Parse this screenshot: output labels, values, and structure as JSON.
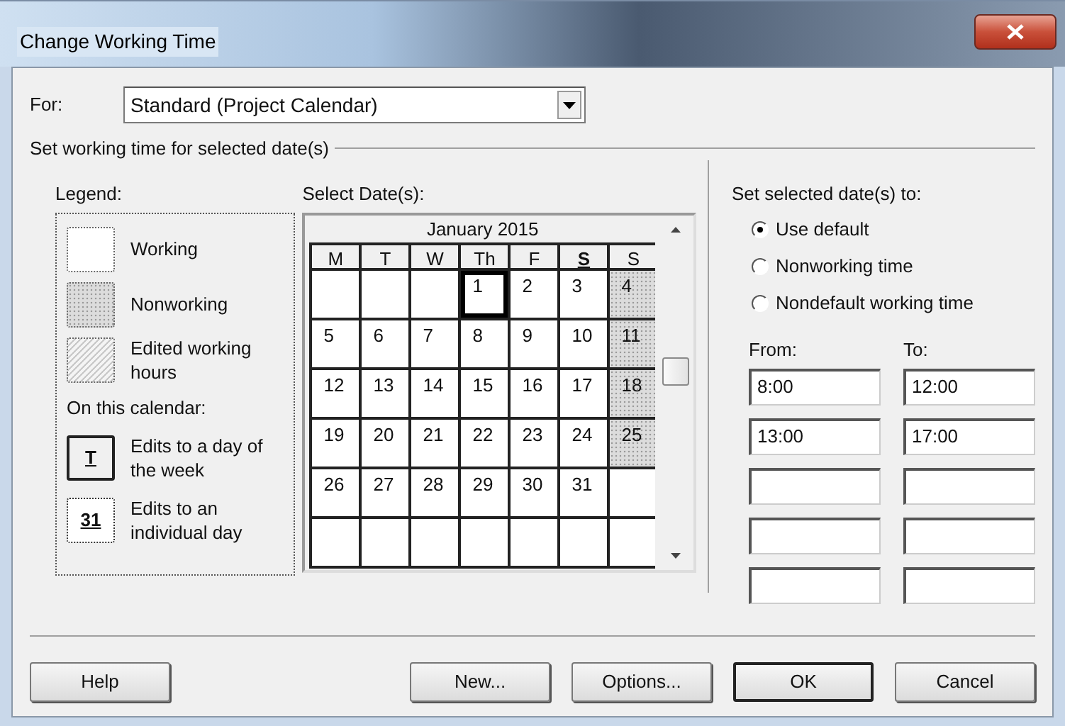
{
  "window": {
    "title": "Change Working Time"
  },
  "for_field": {
    "label": "For:",
    "value": "Standard (Project Calendar)"
  },
  "section_title": "Set working time for selected date(s)",
  "legend": {
    "title": "Legend:",
    "items": [
      {
        "kind": "working",
        "label": "Working"
      },
      {
        "kind": "nonworking",
        "label": "Nonworking"
      },
      {
        "kind": "edited",
        "label": "Edited working hours"
      }
    ],
    "subtitle": "On this calendar:",
    "calendar_items": [
      {
        "kind": "weekday",
        "symbol": "T",
        "label": "Edits to a day of the week"
      },
      {
        "kind": "day",
        "symbol": "31",
        "label": "Edits to an individual day"
      }
    ]
  },
  "calendar": {
    "label": "Select Date(s):",
    "month": "January 2015",
    "headers": [
      {
        "label": "M",
        "marked": false
      },
      {
        "label": "T",
        "marked": false
      },
      {
        "label": "W",
        "marked": false
      },
      {
        "label": "Th",
        "marked": false
      },
      {
        "label": "F",
        "marked": false
      },
      {
        "label": "S",
        "marked": true
      },
      {
        "label": "S",
        "marked": false
      }
    ],
    "weeks": [
      [
        {
          "kind": "blank",
          "selected": false
        },
        {
          "kind": "blank",
          "selected": false
        },
        {
          "kind": "blank",
          "selected": false
        },
        {
          "kind": "working",
          "day": "1",
          "selected": true
        },
        {
          "kind": "working",
          "day": "2",
          "selected": false
        },
        {
          "kind": "working",
          "day": "3",
          "selected": false
        },
        {
          "kind": "nonworking",
          "day": "4",
          "selected": false
        }
      ],
      [
        {
          "kind": "working",
          "day": "5",
          "selected": false
        },
        {
          "kind": "working",
          "day": "6",
          "selected": false
        },
        {
          "kind": "working",
          "day": "7",
          "selected": false
        },
        {
          "kind": "working",
          "day": "8",
          "selected": false
        },
        {
          "kind": "working",
          "day": "9",
          "selected": false
        },
        {
          "kind": "working",
          "day": "10",
          "selected": false
        },
        {
          "kind": "nonworking",
          "day": "11",
          "selected": false
        }
      ],
      [
        {
          "kind": "working",
          "day": "12",
          "selected": false
        },
        {
          "kind": "working",
          "day": "13",
          "selected": false
        },
        {
          "kind": "working",
          "day": "14",
          "selected": false
        },
        {
          "kind": "working",
          "day": "15",
          "selected": false
        },
        {
          "kind": "working",
          "day": "16",
          "selected": false
        },
        {
          "kind": "working",
          "day": "17",
          "selected": false
        },
        {
          "kind": "nonworking",
          "day": "18",
          "selected": false
        }
      ],
      [
        {
          "kind": "working",
          "day": "19",
          "selected": false
        },
        {
          "kind": "working",
          "day": "20",
          "selected": false
        },
        {
          "kind": "working",
          "day": "21",
          "selected": false
        },
        {
          "kind": "working",
          "day": "22",
          "selected": false
        },
        {
          "kind": "working",
          "day": "23",
          "selected": false
        },
        {
          "kind": "working",
          "day": "24",
          "selected": false
        },
        {
          "kind": "nonworking",
          "day": "25",
          "selected": false
        }
      ],
      [
        {
          "kind": "working",
          "day": "26",
          "selected": false
        },
        {
          "kind": "working",
          "day": "27",
          "selected": false
        },
        {
          "kind": "working",
          "day": "28",
          "selected": false
        },
        {
          "kind": "working",
          "day": "29",
          "selected": false
        },
        {
          "kind": "working",
          "day": "30",
          "selected": false
        },
        {
          "kind": "working",
          "day": "31",
          "selected": false
        },
        {
          "kind": "blank",
          "selected": false
        }
      ],
      [
        {
          "kind": "blank",
          "selected": false
        },
        {
          "kind": "blank",
          "selected": false
        },
        {
          "kind": "blank",
          "selected": false
        },
        {
          "kind": "blank",
          "selected": false
        },
        {
          "kind": "blank",
          "selected": false
        },
        {
          "kind": "blank",
          "selected": false
        },
        {
          "kind": "blank",
          "selected": false
        }
      ]
    ]
  },
  "set_to": {
    "title": "Set selected date(s) to:",
    "options": [
      {
        "label": "Use default",
        "selected": true
      },
      {
        "label": "Nonworking time",
        "selected": false
      },
      {
        "label": "Nondefault working time",
        "selected": false
      }
    ],
    "from_label": "From:",
    "to_label": "To:",
    "times": [
      {
        "from": "8:00",
        "to": "12:00"
      },
      {
        "from": "13:00",
        "to": "17:00"
      }
    ]
  },
  "buttons": [
    {
      "label": "Help",
      "default": false
    },
    {
      "label": "New...",
      "default": false
    },
    {
      "label": "Options...",
      "default": false
    },
    {
      "label": "OK",
      "default": true
    },
    {
      "label": "Cancel",
      "default": false
    }
  ]
}
